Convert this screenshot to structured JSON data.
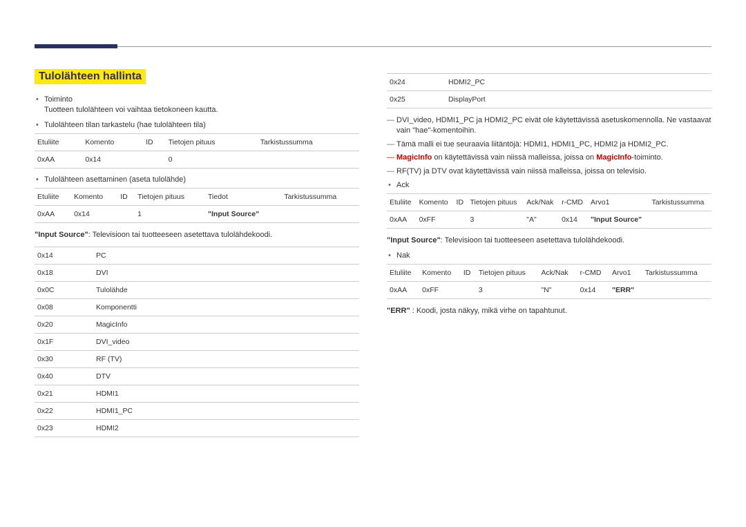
{
  "heading": "Tulolähteen hallinta",
  "left": {
    "toiminto_label": "Toiminto",
    "toiminto_desc": "Tuotteen tulolähteen voi vaihtaa tietokoneen kautta.",
    "view_label": "Tulolähteen tilan tarkastelu (hae tulolähteen tila)",
    "set_label": "Tulolähteen asettaminen (aseta tulolähde)",
    "table1_headers": [
      "Etuliite",
      "Komento",
      "ID",
      "Tietojen pituus",
      "Tarkistussumma"
    ],
    "table1_row": [
      "0xAA",
      "0x14",
      "",
      "0",
      ""
    ],
    "table2_headers": [
      "Etuliite",
      "Komento",
      "ID",
      "Tietojen pituus",
      "Tiedot",
      "Tarkistussumma"
    ],
    "table2_row": [
      "0xAA",
      "0x14",
      "",
      "1",
      "\"Input Source\"",
      ""
    ],
    "input_source_desc_label": "\"Input Source\"",
    "input_source_desc_text": ": Televisioon tai tuotteeseen asetettava tulolähdekoodi.",
    "codes": [
      [
        "0x14",
        "PC"
      ],
      [
        "0x18",
        "DVI"
      ],
      [
        "0x0C",
        "Tulolähde"
      ],
      [
        "0x08",
        "Komponentti"
      ],
      [
        "0x20",
        "MagicInfo"
      ],
      [
        "0x1F",
        "DVI_video"
      ],
      [
        "0x30",
        "RF (TV)"
      ],
      [
        "0x40",
        "DTV"
      ],
      [
        "0x21",
        "HDMI1"
      ],
      [
        "0x22",
        "HDMI1_PC"
      ],
      [
        "0x23",
        "HDMI2"
      ]
    ]
  },
  "right": {
    "codes_extra": [
      [
        "0x24",
        "HDMI2_PC"
      ],
      [
        "0x25",
        "DisplayPort"
      ]
    ],
    "note1": "DVI_video, HDMI1_PC ja HDMI2_PC eivät ole käytettävissä asetuskomennolla. Ne vastaavat vain \"hae\"-komentoihin.",
    "note2": "Tämä malli ei tue seuraavia liitäntöjä: HDMI1, HDMI1_PC, HDMI2 ja HDMI2_PC.",
    "note3_a": "MagicInfo",
    "note3_b": " on käytettävissä vain niissä malleissa, joissa on ",
    "note3_c": "MagicInfo",
    "note3_d": "-toiminto.",
    "note4": "RF(TV) ja DTV ovat käytettävissä vain niissä malleissa, joissa on televisio.",
    "ack_label": "Ack",
    "ack_headers": [
      "Etuliite",
      "Komento",
      "ID",
      "Tietojen pituus",
      "Ack/Nak",
      "r-CMD",
      "Arvo1",
      "Tarkistussumma"
    ],
    "ack_row": [
      "0xAA",
      "0xFF",
      "",
      "3",
      "\"A\"",
      "0x14",
      "\"Input Source\"",
      ""
    ],
    "input_source_desc_label": "\"Input Source\"",
    "input_source_desc_text": ": Televisioon tai tuotteeseen asetettava tulolähdekoodi.",
    "nak_label": "Nak",
    "nak_headers": [
      "Etuliite",
      "Komento",
      "ID",
      "Tietojen pituus",
      "Ack/Nak",
      "r-CMD",
      "Arvo1",
      "Tarkistussumma"
    ],
    "nak_row": [
      "0xAA",
      "0xFF",
      "",
      "3",
      "\"N\"",
      "0x14",
      "\"ERR\"",
      ""
    ],
    "err_label": "\"ERR\"",
    "err_text": " : Koodi, josta näkyy, mikä virhe on tapahtunut."
  }
}
